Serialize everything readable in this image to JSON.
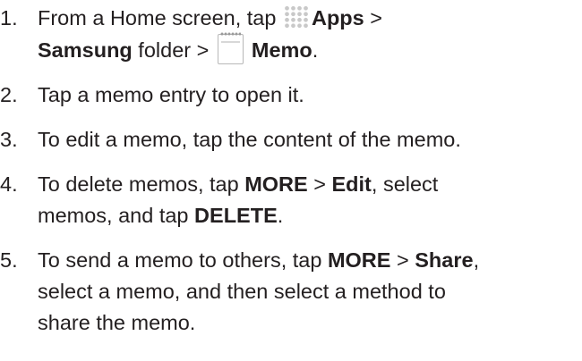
{
  "steps": [
    {
      "num": "1.",
      "line1_prefix": "From a Home screen, tap ",
      "apps_label": "Apps",
      "line1_suffix": " >",
      "samsung_label": "Samsung",
      "folder_text": " folder > ",
      "memo_label": "Memo",
      "end_period": ".",
      "icons": [
        "apps-icon",
        "memo-icon"
      ]
    },
    {
      "num": "2.",
      "text": "Tap a memo entry to open it."
    },
    {
      "num": "3.",
      "text": "To edit a memo, tap the content of the memo."
    },
    {
      "num": "4.",
      "prefix": "To delete memos, tap ",
      "more_label": "MORE",
      "sep": " > ",
      "edit_label": "Edit",
      "line1_suffix": ", select",
      "line2_prefix": "memos, and tap ",
      "delete_label": "DELETE",
      "end_period": "."
    },
    {
      "num": "5.",
      "prefix": "To send a memo to others, tap ",
      "more_label": "MORE",
      "sep": " > ",
      "share_label": "Share",
      "comma": ",",
      "line2": "select a memo, and then select a method to",
      "line3": "share the memo."
    }
  ]
}
